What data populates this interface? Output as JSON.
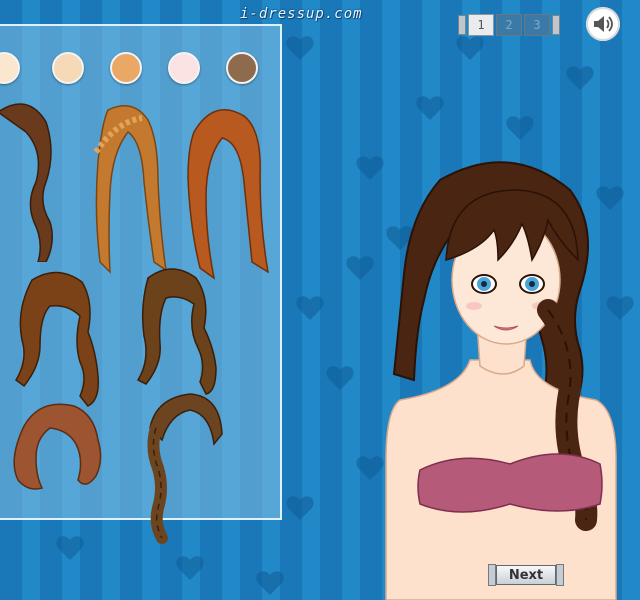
{
  "header": {
    "site_logo": "i-dressup.com"
  },
  "pager": {
    "pages": [
      "1",
      "2",
      "3"
    ],
    "active_page": "1"
  },
  "sound": {
    "icon": "speaker-icon"
  },
  "panel": {
    "skin_swatches": [
      "#fbe6cf",
      "#f6d9b6",
      "#eaa867",
      "#fbe3e3",
      "#8d6b4c"
    ],
    "hairstyles": [
      "braid-side",
      "crown-braid",
      "long-straight",
      "long-wavy",
      "medium-wavy",
      "short-curly",
      "single-braid"
    ]
  },
  "actions": {
    "next_label": "Next"
  },
  "colors": {
    "background": "#1a78b8",
    "panel": "#96cde8"
  }
}
